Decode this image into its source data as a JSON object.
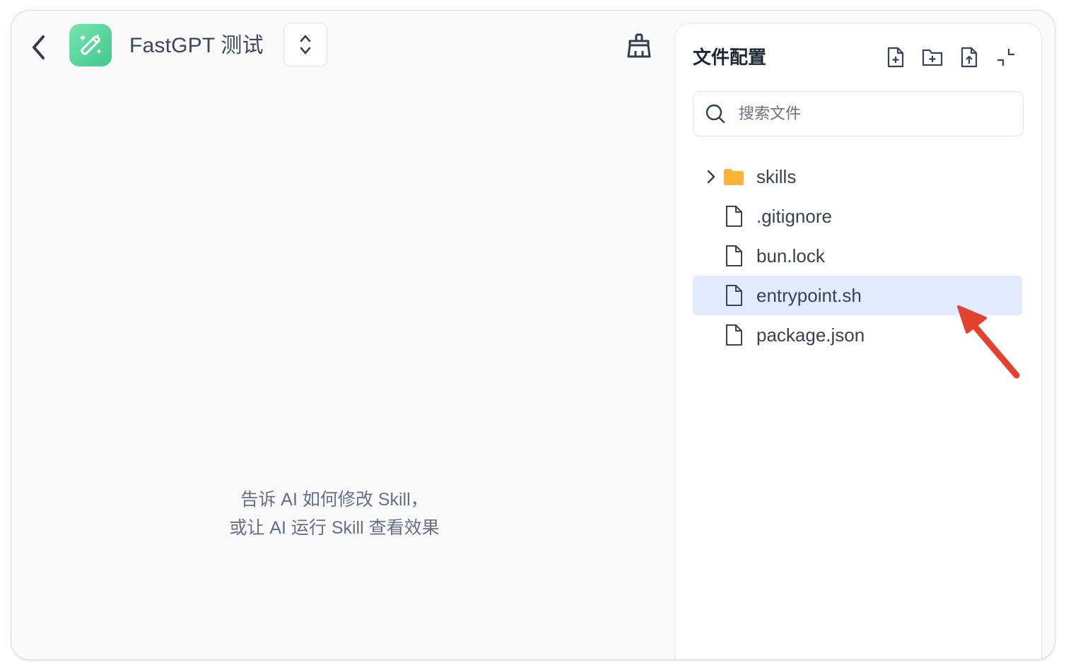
{
  "header": {
    "app_title": "FastGPT 测试",
    "icons": {
      "back": "chevron-left-icon",
      "app": "magic-wand-icon",
      "switch": "chevron-up-down-icon",
      "clear": "broom-icon"
    }
  },
  "main": {
    "hint_line1": "告诉 AI 如何修改 Skill，",
    "hint_line2": "或让 AI 运行 Skill 查看效果"
  },
  "panel": {
    "title": "文件配置",
    "toolbar": [
      "new-file-icon",
      "new-folder-icon",
      "upload-file-icon",
      "collapse-icon"
    ],
    "search": {
      "placeholder": "搜索文件",
      "value": ""
    },
    "tree": [
      {
        "name": "skills",
        "type": "folder",
        "expanded": false
      },
      {
        "name": ".gitignore",
        "type": "file"
      },
      {
        "name": "bun.lock",
        "type": "file"
      },
      {
        "name": "entrypoint.sh",
        "type": "file",
        "selected": true
      },
      {
        "name": "package.json",
        "type": "file"
      }
    ]
  },
  "colors": {
    "accent_green": "#3ec98c",
    "selected_bg": "#e1eaff",
    "folder": "#fbb338",
    "annotation_arrow": "#e0432f"
  }
}
